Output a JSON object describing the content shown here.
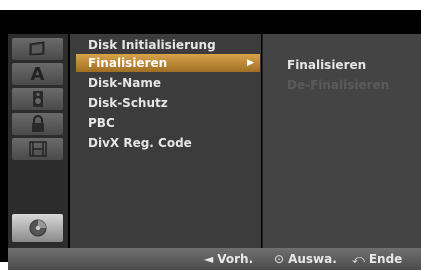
{
  "menu": {
    "items": [
      {
        "label": "Disk Initialisierung"
      },
      {
        "label": "Finalisieren"
      },
      {
        "label": "Disk-Name"
      },
      {
        "label": "Disk-Schutz"
      },
      {
        "label": "PBC"
      },
      {
        "label": "DivX Reg. Code"
      }
    ],
    "selected_index": 1
  },
  "submenu": {
    "items": [
      {
        "label": "Finalisieren",
        "enabled": true
      },
      {
        "label": "De-Finalisieren",
        "enabled": false
      }
    ]
  },
  "sidebar": {
    "icons": [
      {
        "name": "screen-icon"
      },
      {
        "name": "language-icon",
        "glyph": "A"
      },
      {
        "name": "speaker-icon"
      },
      {
        "name": "lock-icon"
      },
      {
        "name": "film-icon"
      },
      {
        "name": "disc-icon",
        "selected": true
      }
    ]
  },
  "bottom_bar": {
    "prev_glyph": "◄",
    "prev_label": "Vorh.",
    "select_glyph": "⊙",
    "select_label": "Auswa.",
    "exit_glyph": "⤺",
    "exit_label": "Ende"
  },
  "colors": {
    "highlight": "#c48a36",
    "text": "#e6e6e6",
    "disabled_text": "#5a5a5a"
  }
}
